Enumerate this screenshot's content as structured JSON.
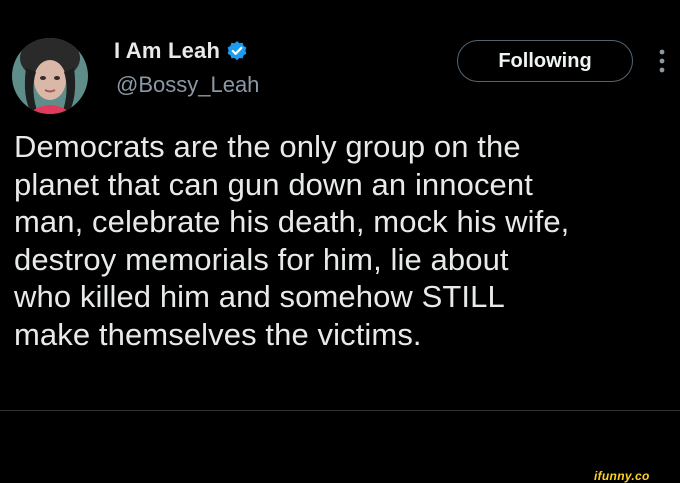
{
  "tweet": {
    "author": {
      "display_name": "I Am Leah",
      "handle": "@Bossy_Leah",
      "verified": true,
      "avatar_icon": "profile-photo"
    },
    "follow_button_label": "Following",
    "more_icon": "vertical-ellipsis-icon",
    "text": "Democrats are the only group on the\nplanet that can gun down an innocent\nman, celebrate his death, mock his wife,\ndestroy memorials for him, lie about\nwho killed him and somehow STILL\nmake themselves the victims."
  },
  "watermark": {
    "text": "ifunny.co"
  },
  "colors": {
    "background": "#000000",
    "text_primary": "#e7e9ea",
    "text_secondary": "#8b98a5",
    "verified_blue": "#1d9bf0",
    "button_border": "#536471",
    "watermark_yellow": "#ffd21f"
  }
}
